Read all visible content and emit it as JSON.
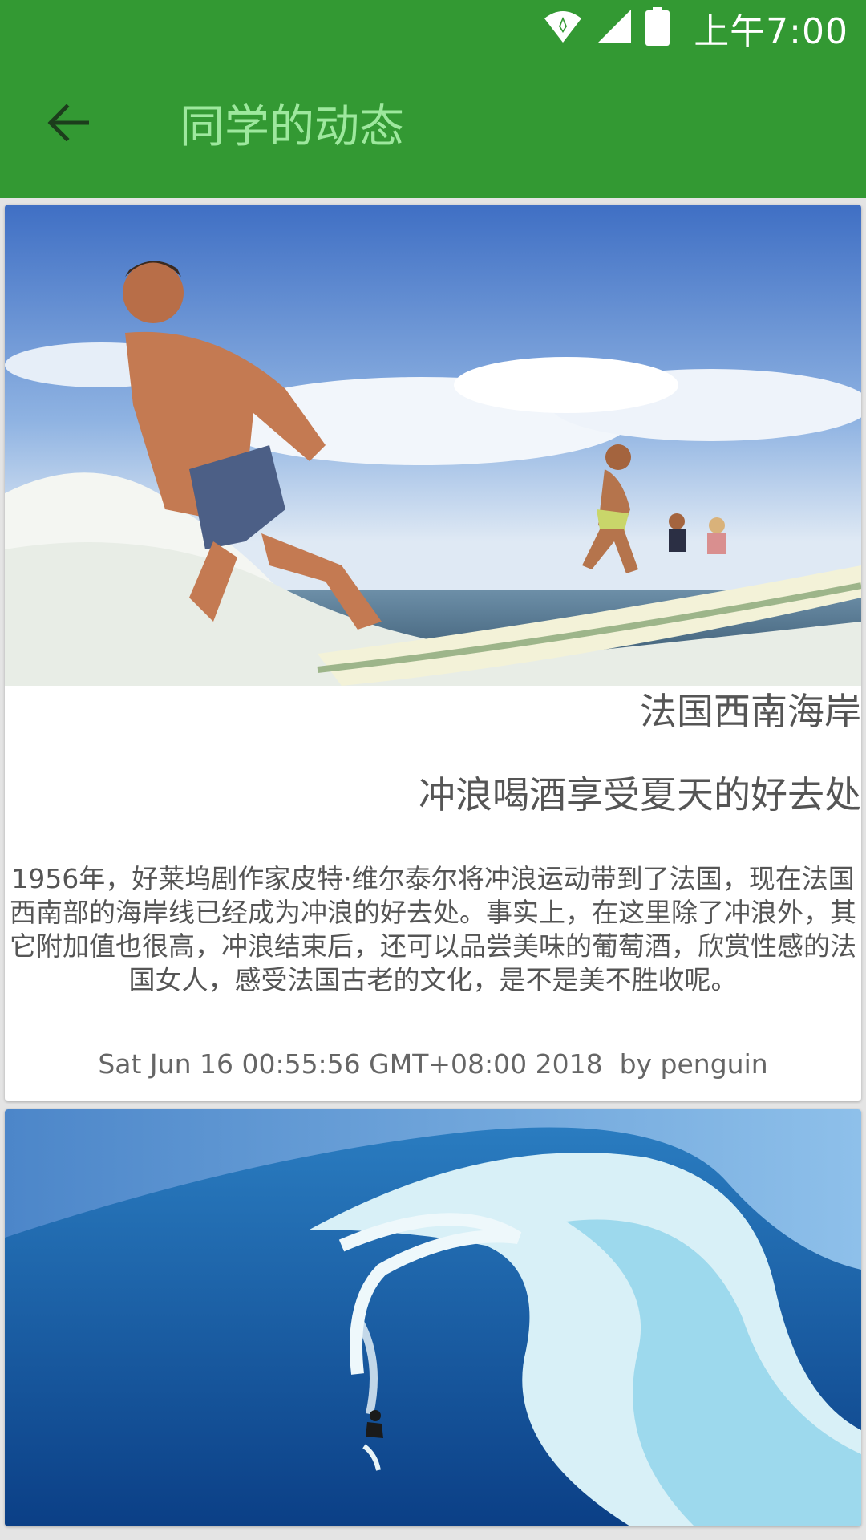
{
  "status_bar": {
    "time": "上午7:00",
    "icons": [
      "wifi-icon",
      "signal-icon",
      "battery-icon"
    ]
  },
  "app_bar": {
    "title": "同学的动态",
    "back_icon": "arrow-back-icon",
    "background": "#339933",
    "title_color": "#9ee89e"
  },
  "feed": {
    "items": [
      {
        "title": "法国西南海岸",
        "subtitle": "冲浪喝酒享受夏天的好去处",
        "body": "1956年，好莱坞剧作家皮特·维尔泰尔将冲浪运动带到了法国，现在法国西南部的海岸线已经成为冲浪的好去处。事实上，在这里除了冲浪外，其它附加值也很高，冲浪结束后，还可以品尝美味的葡萄酒，欣赏性感的法国女人，感受法国古老的文化，是不是美不胜收呢。",
        "timestamp": "Sat Jun 16 00:55:56 GMT+08:00 2018",
        "author_line": "by penguin"
      },
      {
        "image": "big-wave-surfer-photo"
      }
    ]
  }
}
